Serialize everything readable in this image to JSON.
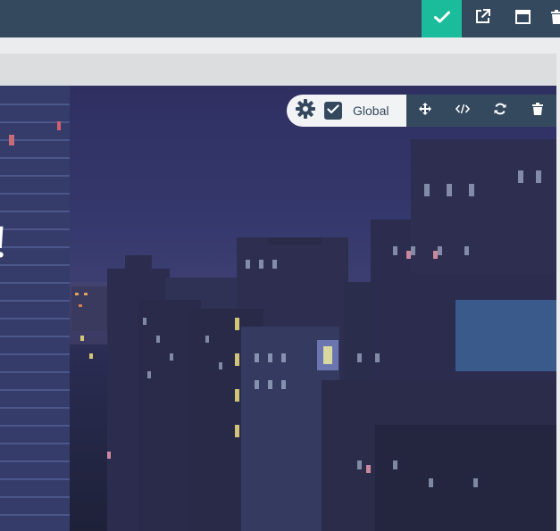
{
  "topbar": {
    "actions": [
      {
        "name": "check-icon",
        "color": "#1abc9c"
      },
      {
        "name": "external-link-icon"
      },
      {
        "name": "window-icon"
      },
      {
        "name": "trash-icon"
      }
    ],
    "background": "#34495e"
  },
  "hero": {
    "heading": "!"
  },
  "module_toolbar": {
    "global_label": "Global",
    "global_checked": true,
    "icons": [
      "gear-icon",
      "move-icon",
      "code-icon",
      "refresh-icon",
      "trash-icon"
    ]
  },
  "colors": {
    "accent": "#1abc9c",
    "dark": "#34495e",
    "light": "#f2f3f5"
  }
}
